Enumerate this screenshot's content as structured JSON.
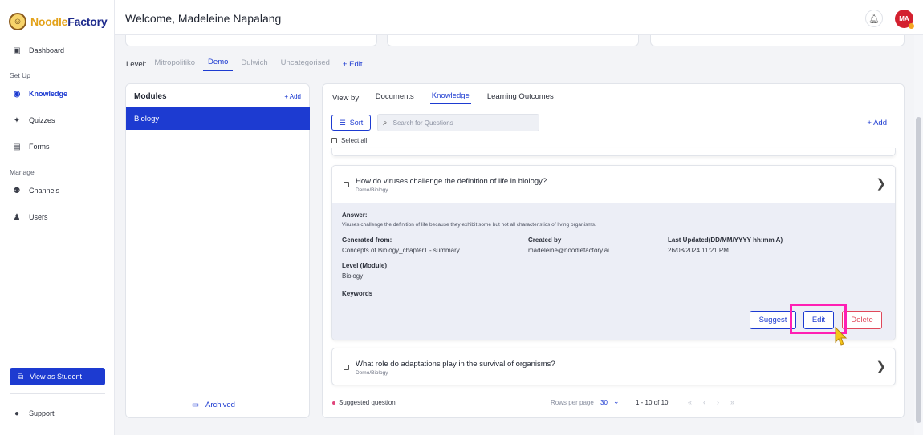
{
  "brand": {
    "name_part1": "Noodle",
    "name_part2": "Factory"
  },
  "sidebar": {
    "items": [
      {
        "label": "Dashboard",
        "icon": "dashboard-icon"
      },
      {
        "label": "Knowledge",
        "icon": "globe-icon"
      },
      {
        "label": "Quizzes",
        "icon": "lightbulb-icon"
      },
      {
        "label": "Forms",
        "icon": "document-icon"
      },
      {
        "label": "Channels",
        "icon": "people-icon"
      },
      {
        "label": "Users",
        "icon": "user-icon"
      }
    ],
    "sections": {
      "setup": "Set Up",
      "manage": "Manage"
    },
    "view_student": "View as Student",
    "support": "Support"
  },
  "header": {
    "welcome": "Welcome, Madeleine Napalang",
    "avatar_initials": "MA"
  },
  "level": {
    "label": "Level:",
    "tabs": [
      "Mitropolitiko",
      "Demo",
      "Dulwich",
      "Uncategorised"
    ],
    "active": "Demo",
    "edit": "+ Edit"
  },
  "modules": {
    "title": "Modules",
    "add": "+ Add",
    "items": [
      "Biology"
    ],
    "archived": "Archived"
  },
  "main": {
    "view_by_label": "View by:",
    "view_options": [
      "Documents",
      "Knowledge",
      "Learning Outcomes"
    ],
    "active_view": "Knowledge",
    "sort": "Sort",
    "search_placeholder": "Search for Questions",
    "add": "+ Add",
    "select_all": "Select all",
    "questions": [
      {
        "title": "How do viruses challenge the definition of life in biology?",
        "path": "Demo/Biology",
        "answer_label": "Answer:",
        "answer": "Viruses challenge the definition of life because they exhibit some but not all characteristics of living organisms.",
        "generated_label": "Generated from:",
        "generated": "Concepts of Biology_chapter1 - summary",
        "created_label": "Created by",
        "created": "madeleine@noodlefactory.ai",
        "updated_label": "Last Updated(DD/MM/YYYY hh:mm A)",
        "updated": "26/08/2024 11:21 PM",
        "level_label": "Level (Module)",
        "level": "Biology",
        "keywords_label": "Keywords",
        "buttons": {
          "suggest": "Suggest",
          "edit": "Edit",
          "delete": "Delete"
        }
      },
      {
        "title": "What role do adaptations play in the survival of organisms?",
        "path": "Demo/Biology"
      }
    ],
    "footer": {
      "suggested": "Suggested question",
      "rows_label": "Rows per page",
      "rows_value": "30",
      "range": "1 - 10 of 10"
    }
  },
  "colors": {
    "primary": "#1d3bd1",
    "danger": "#e0485a",
    "highlight": "#ff1fb4",
    "avatar": "#d3202f"
  }
}
